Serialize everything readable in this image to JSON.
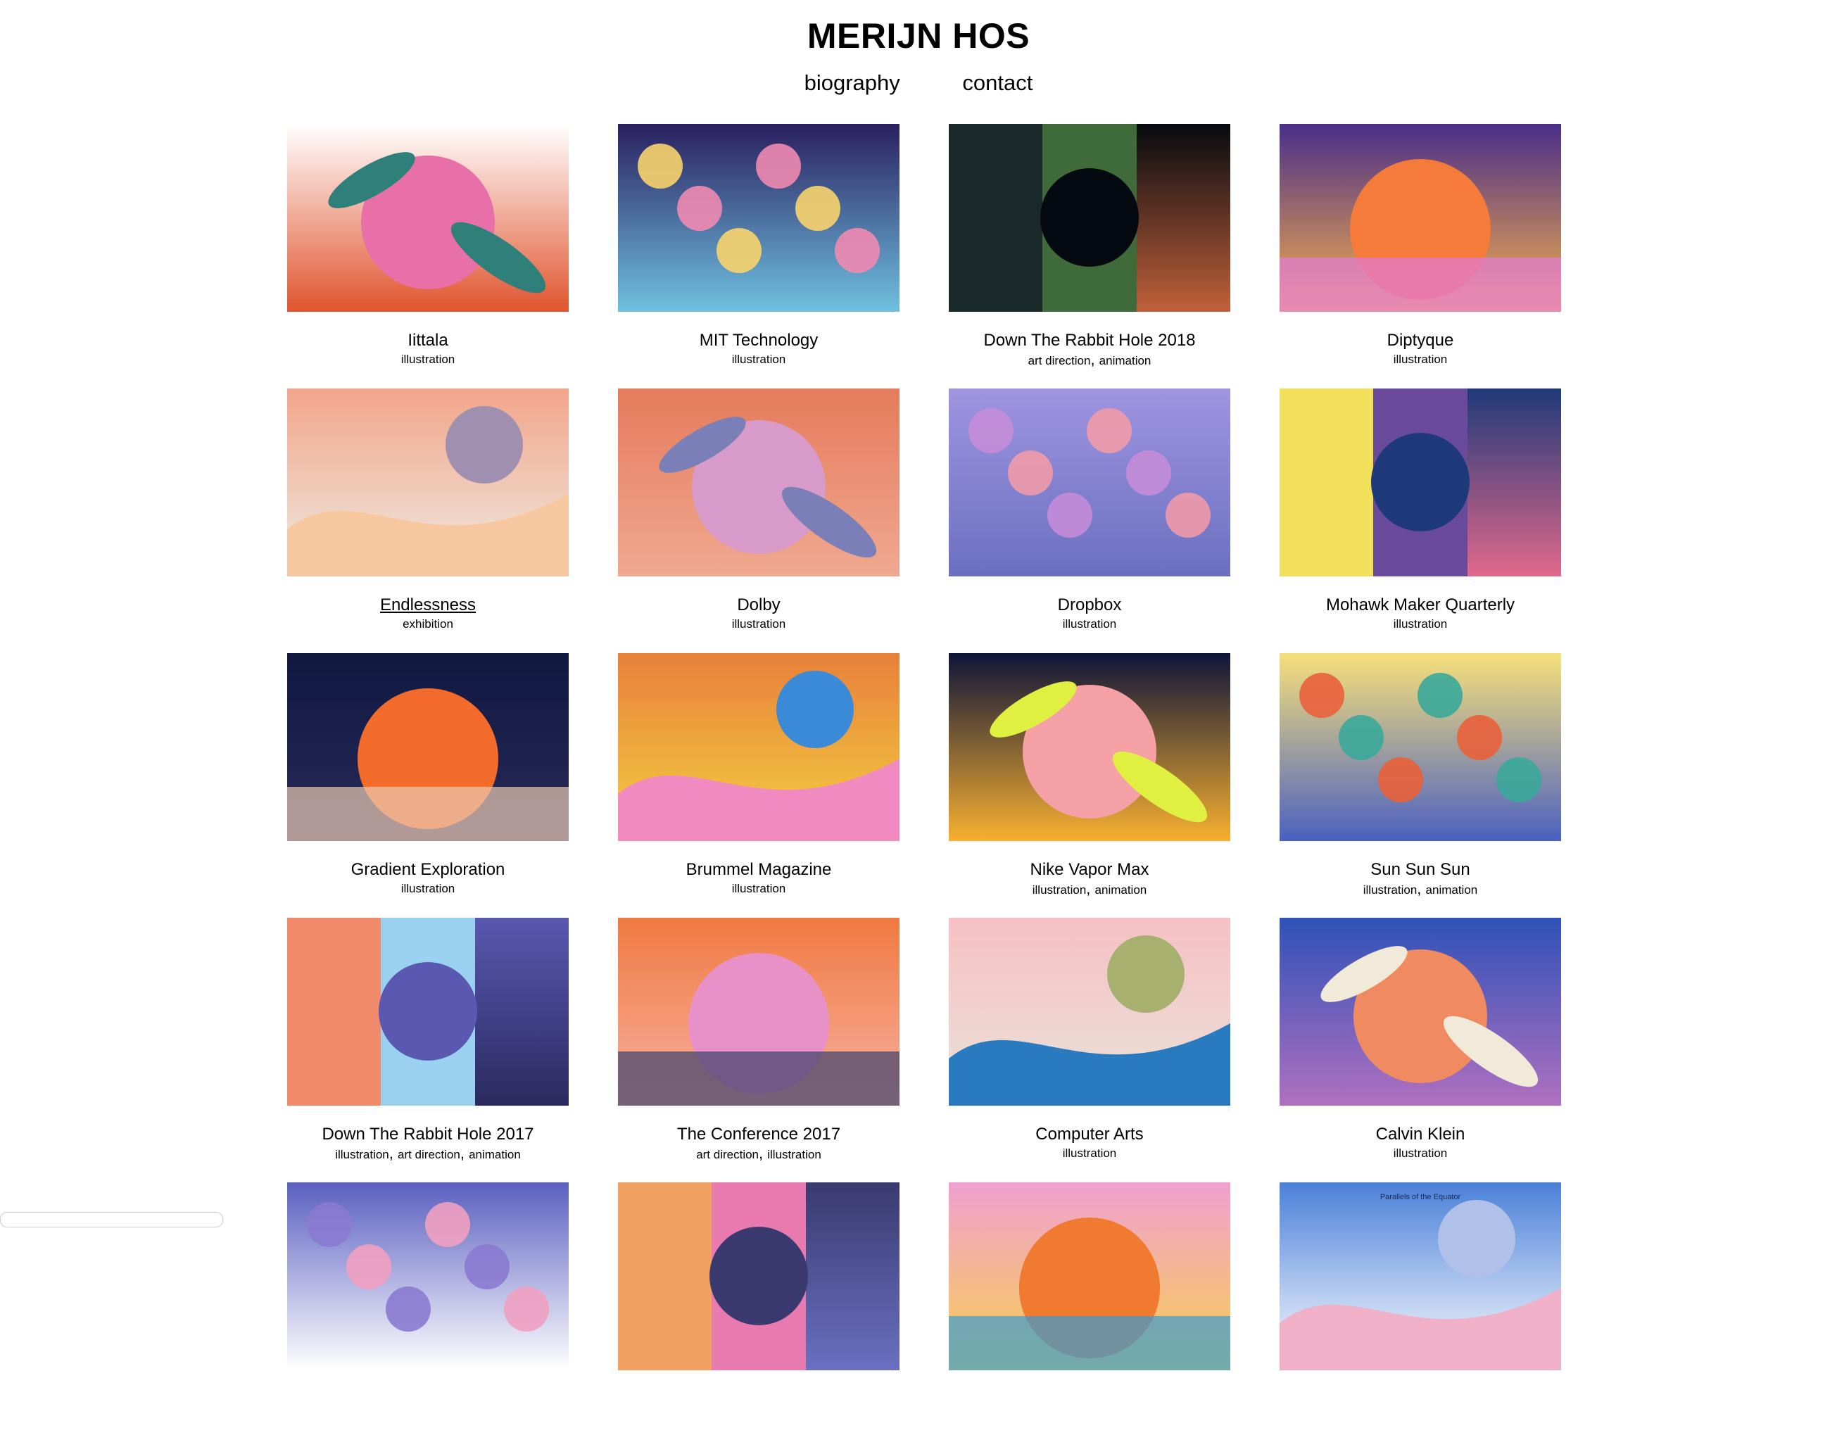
{
  "site": {
    "title": "MERIJN HOS"
  },
  "nav": {
    "items": [
      "biography",
      "contact"
    ]
  },
  "projects": [
    {
      "title": "Iittala",
      "tags": [
        "illustration"
      ],
      "colors": [
        "#ffffff",
        "#e86fa8",
        "#2f7f7a",
        "#e0542e"
      ]
    },
    {
      "title": "MIT Technology",
      "tags": [
        "illustration"
      ],
      "colors": [
        "#2a2060",
        "#f08ab0",
        "#f7d36c",
        "#6fc0e0"
      ]
    },
    {
      "title": "Down The Rabbit Hole 2018",
      "tags": [
        "art direction",
        "animation"
      ],
      "colors": [
        "#050a10",
        "#1a2a2a",
        "#3f6a3a",
        "#c0603a"
      ]
    },
    {
      "title": "Diptyque",
      "tags": [
        "illustration"
      ],
      "colors": [
        "#4a2e8a",
        "#f47b3a",
        "#e27ad8",
        "#f7b04a"
      ]
    },
    {
      "title": "Endlessness",
      "tags": [
        "exhibition"
      ],
      "colors": [
        "#f2a58a",
        "#f7c8a0",
        "#a090b0",
        "#eeeae0"
      ]
    },
    {
      "title": "Dolby",
      "tags": [
        "illustration"
      ],
      "colors": [
        "#e57b5c",
        "#d89ac8",
        "#7a7fb8",
        "#f0a890"
      ]
    },
    {
      "title": "Dropbox",
      "tags": [
        "illustration"
      ],
      "colors": [
        "#9f94e0",
        "#f09aa8",
        "#c48cd8",
        "#6a70c0"
      ]
    },
    {
      "title": "Mohawk Maker Quarterly",
      "tags": [
        "illustration"
      ],
      "colors": [
        "#1f3a7a",
        "#f3e05a",
        "#6a4a9a",
        "#e0688a"
      ]
    },
    {
      "title": "Gradient Exploration",
      "tags": [
        "illustration"
      ],
      "colors": [
        "#101840",
        "#f36c2c",
        "#e9c9b0",
        "#2a2a5a"
      ]
    },
    {
      "title": "Brummel Magazine",
      "tags": [
        "illustration"
      ],
      "colors": [
        "#e8803a",
        "#f08ac0",
        "#3a8ad8",
        "#f3d040"
      ]
    },
    {
      "title": "Nike Vapor Max",
      "tags": [
        "illustration",
        "animation"
      ],
      "colors": [
        "#0e1438",
        "#f4a0a4",
        "#e0f040",
        "#f7b030"
      ]
    },
    {
      "title": "Sun Sun Sun",
      "tags": [
        "illustration",
        "animation"
      ],
      "colors": [
        "#f7e07a",
        "#3aa89a",
        "#e9603a",
        "#4a60c0"
      ]
    },
    {
      "title": "Down The Rabbit Hole 2017",
      "tags": [
        "illustration",
        "art direction",
        "animation"
      ],
      "colors": [
        "#5a58b0",
        "#f08a6a",
        "#9ad0f0",
        "#2a2a60"
      ]
    },
    {
      "title": "The Conference 2017",
      "tags": [
        "art direction",
        "illustration"
      ],
      "colors": [
        "#f07a40",
        "#e890c8",
        "#40406a",
        "#f7b0a0"
      ]
    },
    {
      "title": "Computer Arts",
      "tags": [
        "illustration"
      ],
      "colors": [
        "#f6c0c4",
        "#2a7ac0",
        "#a8b070",
        "#e9e2d8"
      ]
    },
    {
      "title": "Calvin Klein",
      "tags": [
        "illustration"
      ],
      "colors": [
        "#2f52b8",
        "#f08a60",
        "#f2ead8",
        "#b070c0"
      ]
    },
    {
      "title": "",
      "tags": [],
      "colors": [
        "#5a60c0",
        "#f0a0c0",
        "#8a7ad0",
        "#ffffff"
      ]
    },
    {
      "title": "",
      "tags": [],
      "colors": [
        "#3a3a70",
        "#f0a060",
        "#e87ab0",
        "#6a70c0"
      ]
    },
    {
      "title": "",
      "tags": [],
      "colors": [
        "#f0a0d0",
        "#f07a30",
        "#3a9ad0",
        "#f7d050"
      ]
    },
    {
      "title": "",
      "tags": [],
      "colors": [
        "#4a80d8",
        "#f0b0c8",
        "#b0c0e8",
        "#ffffff"
      ],
      "caption": "Parallels of the Equator"
    }
  ]
}
